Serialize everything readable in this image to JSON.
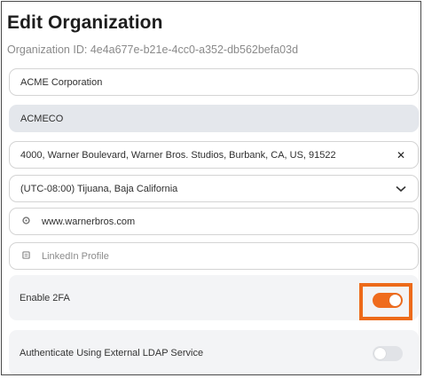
{
  "page": {
    "title": "Edit Organization",
    "org_id_label": "Organization ID:",
    "org_id_value": "4e4a677e-b21e-4cc0-a352-db562befa03d"
  },
  "fields": {
    "name": "ACME Corporation",
    "code": "ACMECO",
    "address": "4000, Warner Boulevard, Warner Bros. Studios, Burbank, CA, US, 91522",
    "address_clear_icon": "close-icon",
    "timezone": "(UTC-08:00) Tijuana, Baja California",
    "timezone_icon": "chevron-down-icon",
    "website": "www.warnerbros.com",
    "website_icon": "globe-icon",
    "linkedin_placeholder": "LinkedIn Profile",
    "linkedin_icon": "linkedin-icon"
  },
  "settings": {
    "enable_2fa": {
      "label": "Enable 2FA",
      "enabled": true
    },
    "ldap": {
      "label": "Authenticate Using External LDAP Service",
      "enabled": false
    }
  },
  "colors": {
    "accent": "#ef6c1e",
    "highlight": "#ed6b1a",
    "toggle_off": "#e1e3e7",
    "disabled_field": "#e4e7ec"
  }
}
